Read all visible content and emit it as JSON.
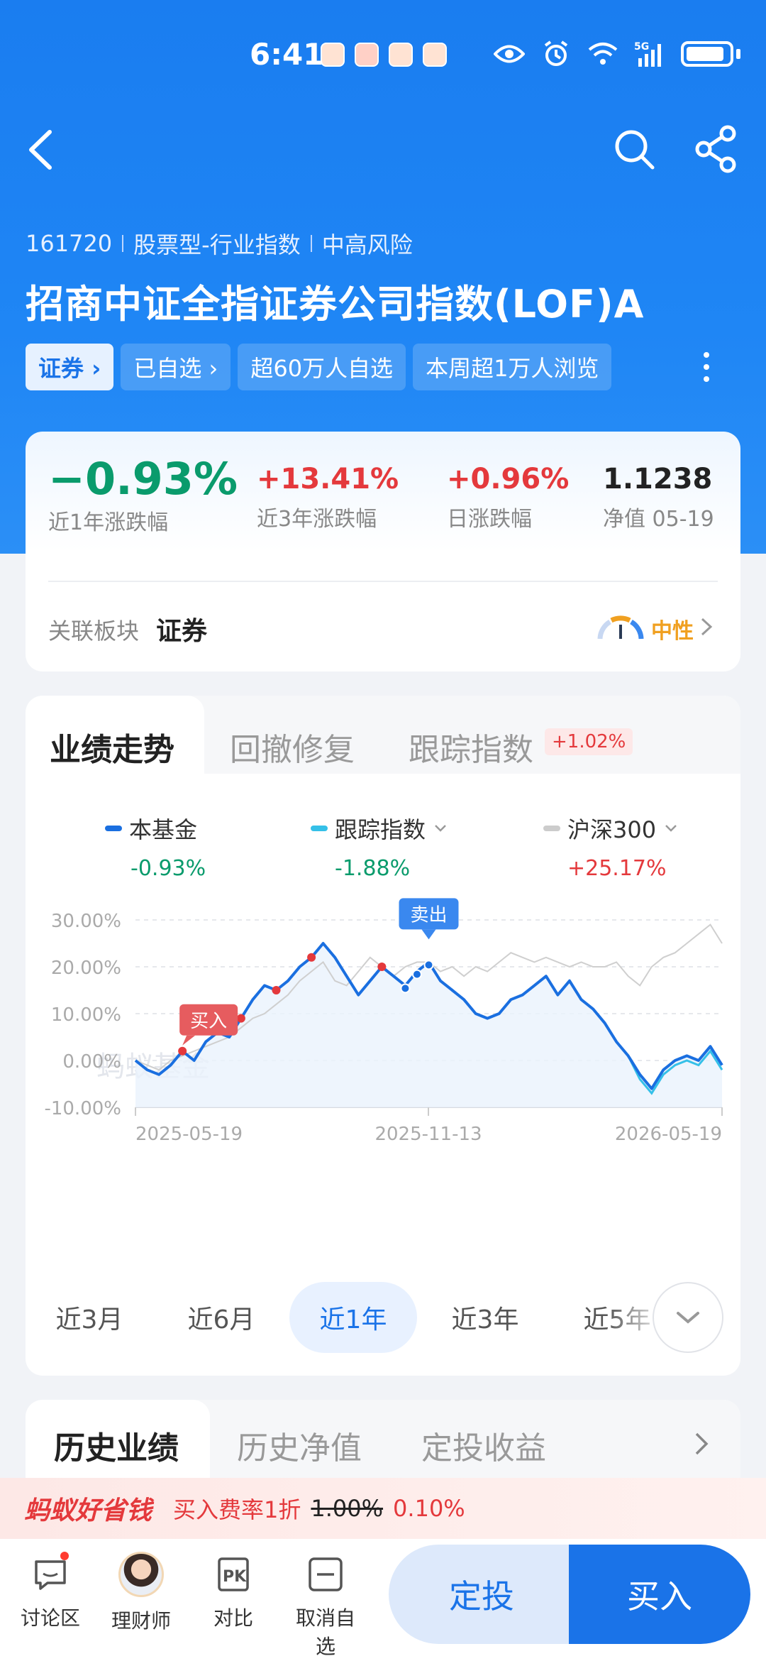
{
  "status_bar": {
    "time": "6:41",
    "network": "5G"
  },
  "fund": {
    "code": "161720",
    "type": "股票型-行业指数",
    "risk": "中高风险",
    "title": "招商中证全指证券公司指数(LOF)A",
    "chips": [
      "证券 ›",
      "已自选 ›",
      "超60万人自选",
      "本周超1万人浏览"
    ]
  },
  "summary": {
    "m1_value": "−0.93%",
    "m1_label": "近1年涨跌幅",
    "m2_value": "+13.41%",
    "m2_label": "近3年涨跌幅",
    "m3_value": "+0.96%",
    "m3_label": "日涨跌幅",
    "m4_value": "1.1238",
    "m4_label": "净值 05-19",
    "sector_label": "关联板块",
    "sector_name": "证券",
    "sentiment": "中性"
  },
  "chart_tabs": {
    "t1": "业绩走势",
    "t2": "回撤修复",
    "t3": "跟踪指数",
    "badge": "+1.02%"
  },
  "legend": [
    {
      "name": "本基金",
      "value": "-0.93%",
      "color": "#1a6fe0"
    },
    {
      "name": "跟踪指数",
      "value": "-1.88%",
      "color": "#35c0e8"
    },
    {
      "name": "沪深300",
      "value": "+25.17%",
      "color": "#cccccc"
    }
  ],
  "chart_text": {
    "ticks_y": [
      "30.00%",
      "20.00%",
      "10.00%",
      "0.00%",
      "-10.00%"
    ],
    "ticks_x": [
      "2025-05-19",
      "2025-11-13",
      "2026-05-19"
    ],
    "buy_tag": "买入",
    "sell_tag": "卖出",
    "watermark": "蚂蚁基金"
  },
  "chart_data": {
    "type": "line",
    "ylim": [
      -10,
      30
    ],
    "x_range": [
      "2025-05-19",
      "2026-05-19"
    ],
    "series": [
      {
        "name": "本基金",
        "values": [
          0,
          -2,
          -3,
          -1,
          2,
          0,
          4,
          6,
          5,
          9,
          13,
          16,
          15,
          17,
          20,
          22,
          25,
          22,
          18,
          14,
          17,
          20,
          18,
          16,
          19,
          21,
          17,
          15,
          13,
          10,
          9,
          10,
          13,
          14,
          16,
          18,
          14,
          17,
          13,
          11,
          8,
          4,
          1,
          -3,
          -6,
          -2,
          0,
          1,
          0,
          3,
          -1
        ]
      },
      {
        "name": "跟踪指数",
        "values": [
          0,
          -2,
          -3,
          -1,
          2,
          0,
          4,
          6,
          5,
          9,
          13,
          16,
          15,
          17,
          20,
          22,
          25,
          22,
          18,
          14,
          17,
          20,
          18,
          16,
          19,
          21,
          17,
          15,
          13,
          10,
          9,
          10,
          13,
          14,
          16,
          18,
          14,
          17,
          13,
          11,
          8,
          4,
          1,
          -4,
          -7,
          -3,
          -1,
          0,
          -1,
          2,
          -2
        ]
      },
      {
        "name": "沪深300",
        "values": [
          0,
          -1,
          -2,
          0,
          1,
          2,
          3,
          4,
          5,
          7,
          9,
          10,
          12,
          14,
          17,
          19,
          21,
          17,
          16,
          19,
          22,
          20,
          18,
          20,
          21,
          21,
          19,
          20,
          18,
          20,
          19,
          21,
          23,
          22,
          21,
          22,
          21,
          20,
          21,
          20,
          20,
          21,
          18,
          16,
          20,
          22,
          23,
          25,
          27,
          29,
          25
        ]
      }
    ]
  },
  "ranges": [
    "近3月",
    "近6月",
    "近1年",
    "近3年",
    "近5年"
  ],
  "history_tabs": [
    "历史业绩",
    "历史净值",
    "定投收益"
  ],
  "promo": {
    "brand": "蚂蚁好省钱",
    "text": "买入费率1折",
    "old_rate": "1.00%",
    "new_rate": "0.10%"
  },
  "bottom": {
    "discuss": "讨论区",
    "advisor": "理财师",
    "compare": "对比",
    "unwatch": "取消自选",
    "dingtou": "定投",
    "buy": "买入"
  }
}
